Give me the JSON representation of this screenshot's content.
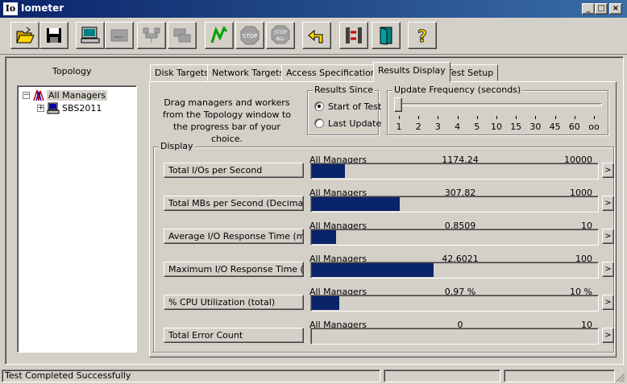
{
  "window": {
    "title": "Iometer",
    "app_icon_text": "Io",
    "minimize": "_",
    "maximize": "□",
    "close": "×"
  },
  "toolbar": {
    "buttons": [
      {
        "name": "open-config-button",
        "icon": "folder-open-icon"
      },
      {
        "name": "save-config-button",
        "icon": "floppy-disk-icon"
      },
      {
        "name": "new-manager-button",
        "icon": "computer-icon"
      },
      {
        "name": "new-disk-worker-button",
        "icon": "disk-worker-icon"
      },
      {
        "name": "new-network-worker-button",
        "icon": "network-worker-icon"
      },
      {
        "name": "duplicate-worker-button",
        "icon": "duplicate-worker-icon"
      },
      {
        "name": "start-tests-button",
        "icon": "green-flag-icon"
      },
      {
        "name": "stop-button",
        "icon": "stop-sign-icon",
        "label": "STOP"
      },
      {
        "name": "stop-all-button",
        "icon": "stop-all-sign-icon",
        "label": "STOP ALL"
      },
      {
        "name": "reset-workers-button",
        "icon": "reset-arrow-icon"
      },
      {
        "name": "disconnect-button",
        "icon": "disconnect-icon"
      },
      {
        "name": "exit-button",
        "icon": "exit-door-icon"
      },
      {
        "name": "about-button",
        "icon": "question-mark-icon",
        "label": "?"
      }
    ]
  },
  "topology": {
    "label": "Topology",
    "root": "All Managers",
    "child": "SBS2011",
    "expander_root": "−",
    "expander_child": "+"
  },
  "tabs": [
    {
      "label": "Disk Targets",
      "active": false
    },
    {
      "label": "Network Targets",
      "active": false
    },
    {
      "label": "Access Specifications",
      "active": false
    },
    {
      "label": "Results Display",
      "active": true
    },
    {
      "label": "Test Setup",
      "active": false
    }
  ],
  "results": {
    "instructions": "Drag managers and workers from the Topology window to the progress bar of your choice.",
    "results_since": {
      "label": "Results Since",
      "options": [
        "Start of Test",
        "Last Update"
      ],
      "selected": "Start of Test"
    },
    "update_frequency": {
      "label": "Update Frequency (seconds)",
      "ticks": [
        "1",
        "2",
        "3",
        "4",
        "5",
        "10",
        "15",
        "30",
        "45",
        "60",
        "oo"
      ],
      "selected": "1"
    },
    "display_label": "Display",
    "metrics": [
      {
        "button": "Total I/Os per Second",
        "source": "All Managers",
        "value": "1174.24",
        "max": "10000",
        "fraction": 0.117
      },
      {
        "button": "Total MBs per Second (Decimal)",
        "source": "All Managers",
        "value": "307.82",
        "max": "1000",
        "fraction": 0.308
      },
      {
        "button": "Average I/O Response Time (ms)",
        "source": "All Managers",
        "value": "0.8509",
        "max": "10",
        "fraction": 0.085
      },
      {
        "button": "Maximum I/O Response Time (ms)",
        "source": "All Managers",
        "value": "42.6021",
        "max": "100",
        "fraction": 0.426
      },
      {
        "button": "% CPU Utilization (total)",
        "source": "All Managers",
        "value": "0.97 %",
        "max": "10 %",
        "fraction": 0.097
      },
      {
        "button": "Total Error Count",
        "source": "All Managers",
        "value": "0",
        "max": "10",
        "fraction": 0.0
      }
    ],
    "arrow": ">"
  },
  "status": {
    "text": "Test Completed Successfully"
  },
  "colors": {
    "bar_fill": "#0a246a",
    "face": "#d4d0c8",
    "title_bar": "#0a246a"
  }
}
